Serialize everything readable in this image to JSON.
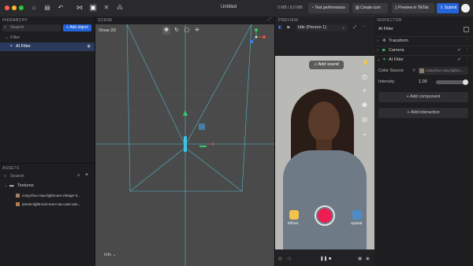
{
  "topbar": {
    "title": "Untitled",
    "memory": "0 MB / 8.0 MB",
    "test_performance": "Test performance",
    "create_icon": "Create icon",
    "preview_tiktok": "Preview in TikTok",
    "submit": "Submit"
  },
  "hierarchy": {
    "title": "HIERARCHY",
    "search_placeholder": "Search",
    "add_object": "+ Add object",
    "filter_group": "Filter",
    "selected_item": "AI Filter"
  },
  "assets": {
    "title": "ASSETS",
    "search_placeholder": "Search",
    "folder": "Textures",
    "files": [
      "cong-thuc-mau-lightroom-vintage-3...",
      "preset-lightroom-tone-nau-cam-san..."
    ]
  },
  "scene": {
    "title": "SCENE",
    "show_label": "Show 2D",
    "info_label": "Info"
  },
  "preview": {
    "title": "PREVIEW",
    "camera_label": "Idle (Person 1)",
    "add_sound": "Add sound",
    "effects_label": "Effects",
    "upload_label": "Upload"
  },
  "inspector": {
    "title": "INSPECTOR",
    "object_name": "AI Filter",
    "components": [
      "Transform",
      "Camera",
      "AI Filter"
    ],
    "color_source_label": "Color Source",
    "color_source_value": "cong-thuc-mau-lightro...",
    "intensity_label": "Intensity",
    "intensity_value": "1.00",
    "intensity_fraction": 1.0,
    "add_component": "+ Add component",
    "add_interaction": "+ Add interaction"
  },
  "colors": {
    "accent": "#2563d8",
    "record": "#ee1d52",
    "selected_row": "#2b3a5c"
  }
}
